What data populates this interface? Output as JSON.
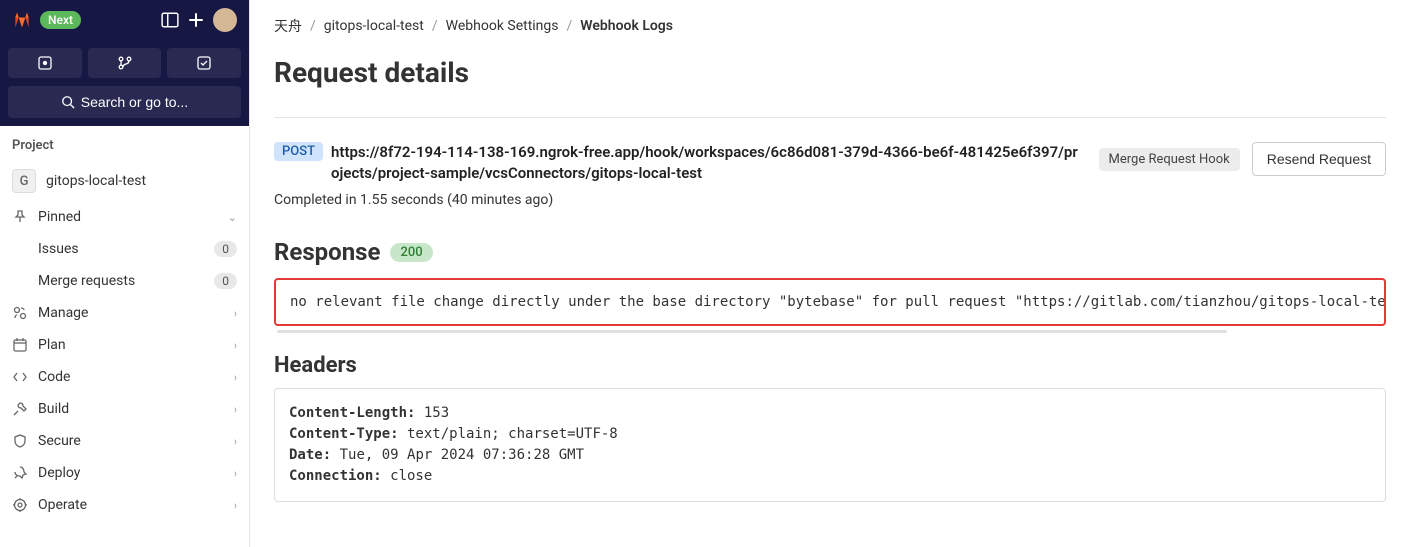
{
  "topbar": {
    "next_label": "Next"
  },
  "search": {
    "label": "Search or go to..."
  },
  "sidebar": {
    "section_label": "Project",
    "project_letter": "G",
    "project_name": "gitops-local-test",
    "pinned_label": "Pinned",
    "issues_label": "Issues",
    "issues_count": "0",
    "mr_label": "Merge requests",
    "mr_count": "0",
    "manage_label": "Manage",
    "plan_label": "Plan",
    "code_label": "Code",
    "build_label": "Build",
    "secure_label": "Secure",
    "deploy_label": "Deploy",
    "operate_label": "Operate"
  },
  "breadcrumb": {
    "c1": "天舟",
    "c2": "gitops-local-test",
    "c3": "Webhook Settings",
    "c4": "Webhook Logs"
  },
  "page": {
    "title": "Request details",
    "method": "POST",
    "url": "https://8f72-194-114-138-169.ngrok-free.app/hook/workspaces/6c86d081-379d-4366-be6f-481425e6f397/projects/project-sample/vcsConnectors/gitops-local-test",
    "completed": "Completed in 1.55 seconds (40 minutes ago)",
    "hook_type": "Merge Request Hook",
    "resend_label": "Resend Request"
  },
  "response": {
    "title": "Response",
    "status": "200",
    "body": "no relevant file change directly under the base directory \"bytebase\" for pull request \"https://gitlab.com/tianzhou/gitops-local-test"
  },
  "headers": {
    "title": "Headers",
    "content_length_key": "Content-Length:",
    "content_length_val": " 153",
    "content_type_key": "Content-Type:",
    "content_type_val": " text/plain; charset=UTF-8",
    "date_key": "Date:",
    "date_val": " Tue, 09 Apr 2024 07:36:28 GMT",
    "connection_key": "Connection:",
    "connection_val": " close"
  }
}
